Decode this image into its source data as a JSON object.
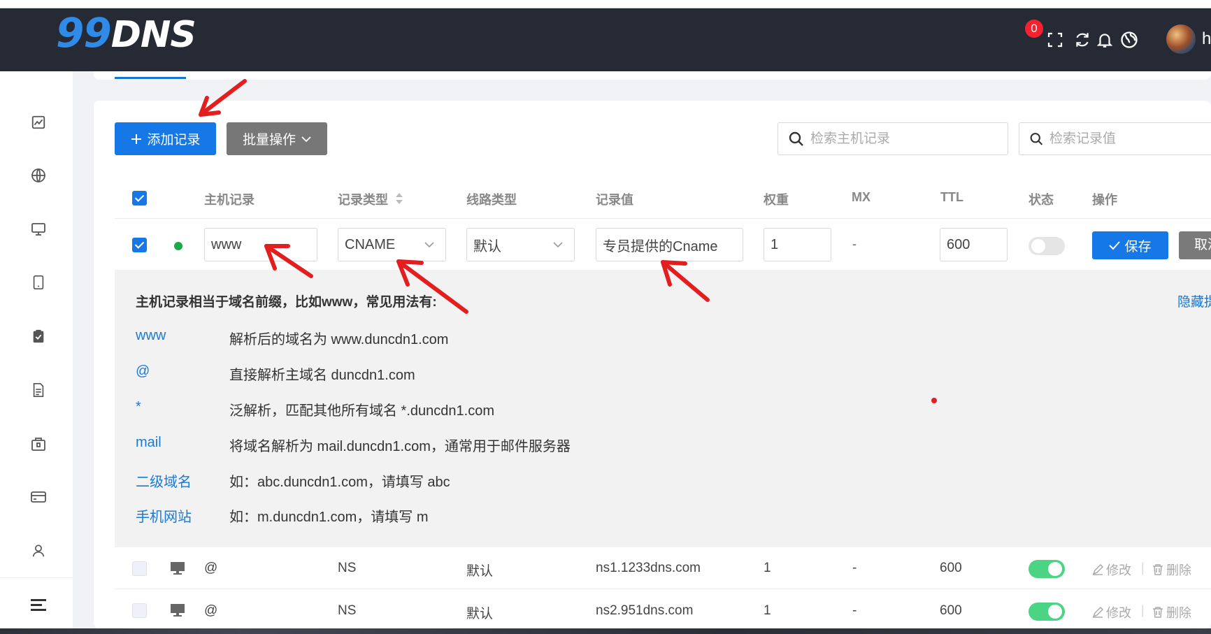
{
  "header": {
    "logo_number": "99",
    "logo_text": "DNS",
    "notification_count": "0",
    "user_initial": "h",
    "icons": [
      "fullscreen-icon",
      "bell-icon",
      "refresh-icon",
      "globe-icon"
    ]
  },
  "sidebar": {
    "icons": [
      "line-chart-icon",
      "globe-icon",
      "monitor-icon",
      "tablet-icon",
      "clipboard-check-icon",
      "document-icon",
      "package-icon",
      "credit-card-icon",
      "user-icon",
      "menu-icon"
    ]
  },
  "toolbar": {
    "add_label": "添加记录",
    "batch_label": "批量操作",
    "search_host_placeholder": "检索主机记录",
    "search_value_placeholder": "检索记录值"
  },
  "table": {
    "headers": {
      "host": "主机记录",
      "type": "记录类型",
      "line": "线路类型",
      "value": "记录值",
      "weight": "权重",
      "mx": "MX",
      "ttl": "TTL",
      "status": "状态",
      "actions": "操作"
    },
    "edit_row": {
      "host": "www",
      "type": "CNAME",
      "line": "默认",
      "value": "专员提供的Cname",
      "weight": "1",
      "mx": "-",
      "ttl": "600",
      "status_on": false,
      "save_label": "保存",
      "cancel_label": "取消"
    },
    "help": {
      "title": "主机记录相当于域名前缀，比如www，常见用法有:",
      "hide_label": "隐藏提示",
      "items": [
        {
          "key": "www",
          "desc": "解析后的域名为 www.duncdn1.com"
        },
        {
          "key": "@",
          "desc": "直接解析主域名 duncdn1.com"
        },
        {
          "key": "*",
          "desc": "泛解析，匹配其他所有域名 *.duncdn1.com"
        },
        {
          "key": "mail",
          "desc": "将域名解析为 mail.duncdn1.com，通常用于邮件服务器"
        },
        {
          "key": "二级域名",
          "desc": "如：abc.duncdn1.com，请填写 abc"
        },
        {
          "key": "手机网站",
          "desc": "如：m.duncdn1.com，请填写 m"
        }
      ]
    },
    "rows": [
      {
        "host": "@",
        "type": "NS",
        "line": "默认",
        "value": "ns1.1233dns.com",
        "weight": "1",
        "mx": "-",
        "ttl": "600",
        "status_on": true,
        "edit_label": "修改",
        "delete_label": "删除"
      },
      {
        "host": "@",
        "type": "NS",
        "line": "默认",
        "value": "ns2.951dns.com",
        "weight": "1",
        "mx": "-",
        "ttl": "600",
        "status_on": true,
        "edit_label": "修改",
        "delete_label": "删除"
      }
    ]
  },
  "colors": {
    "primary": "#1677e6",
    "topbar": "#252a34",
    "success": "#19a94a",
    "toggle_on": "#4ad483",
    "annotation": "#e41e1e"
  }
}
